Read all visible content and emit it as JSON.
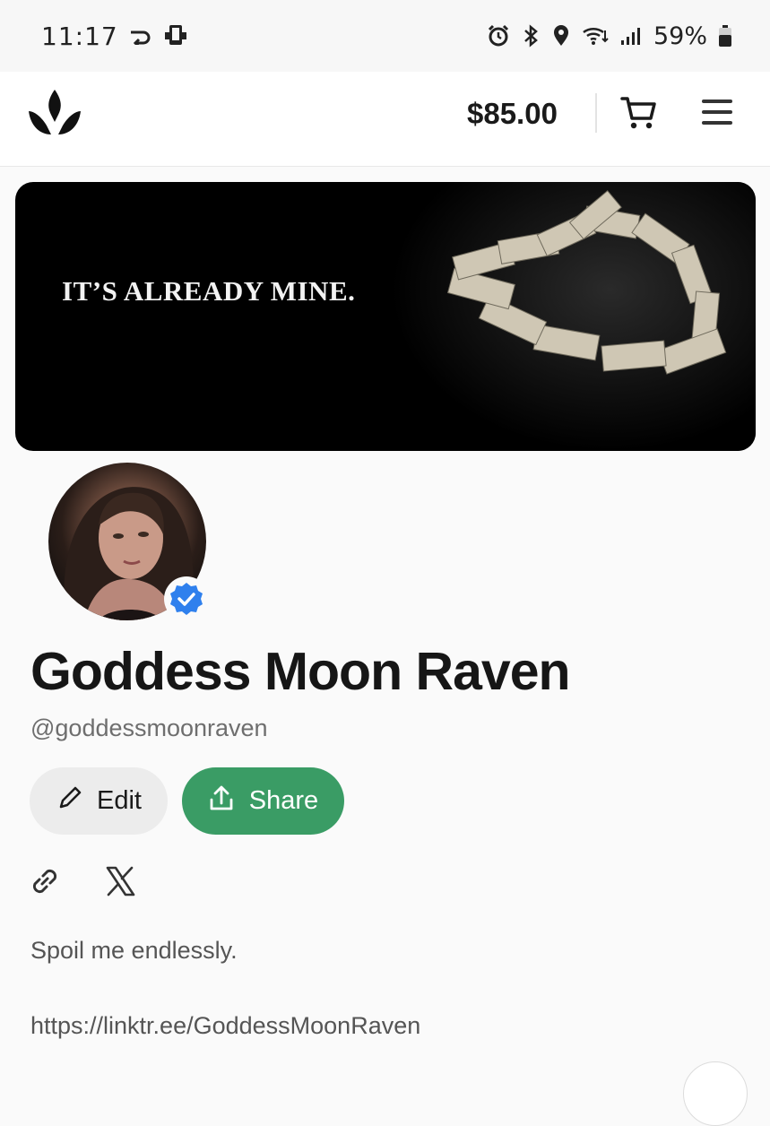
{
  "status_bar": {
    "time": "11:17",
    "battery_text": "59%",
    "icons": [
      "arrow-return-icon",
      "device-icon",
      "alarm-icon",
      "bluetooth-icon",
      "location-icon",
      "wifi-icon",
      "signal-icon",
      "battery-icon"
    ]
  },
  "header": {
    "logo": "crown-logo",
    "balance": "$85.00",
    "cart_icon": "cart-icon",
    "menu_icon": "hamburger-menu-icon"
  },
  "banner": {
    "text": "IT’S ALREADY MINE."
  },
  "profile": {
    "name": "Goddess Moon Raven",
    "handle": "@goddessmoonraven",
    "verified": true,
    "edit_label": "Edit",
    "share_label": "Share",
    "bio": "Spoil me endlessly.\n\nhttps://linktr.ee/GoddessMoonRaven"
  },
  "colors": {
    "share_button": "#3a9c65",
    "verified_badge": "#2f80ed",
    "banner_bg": "#000000"
  }
}
